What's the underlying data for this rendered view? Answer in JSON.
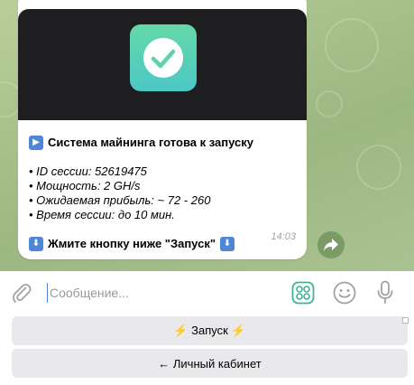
{
  "message": {
    "title": "Система майнинга готова к запуску",
    "title_emoji": "▶",
    "details": [
      "• ID сессии: 52619475",
      "• Мощность: 2 GH/s",
      "• Ожидаемая прибыль: ~ 72 - 260",
      "• Время сессии: до 10 мин."
    ],
    "cta": "Жмите кнопку ниже \"Запуск\"",
    "cta_emoji": "⬇",
    "time": "14:03"
  },
  "composer": {
    "placeholder": "Сообщение..."
  },
  "keyboard": {
    "buttons": [
      "⚡ Запуск ⚡",
      "← Личный кабинет"
    ]
  },
  "colors": {
    "chat_background": "#a9c291",
    "icon_gradient_top": "#64d8a8",
    "icon_gradient_bottom": "#4cc7c6",
    "accent": "#4f86d8",
    "keyboard_button": "#e9e9eb"
  },
  "icons": {
    "app_icon": "checkmark-icon",
    "forward": "forward-arrow-icon",
    "attach": "paperclip-icon",
    "commands": "grid-icon",
    "emoji": "smiley-icon",
    "voice": "microphone-icon"
  }
}
